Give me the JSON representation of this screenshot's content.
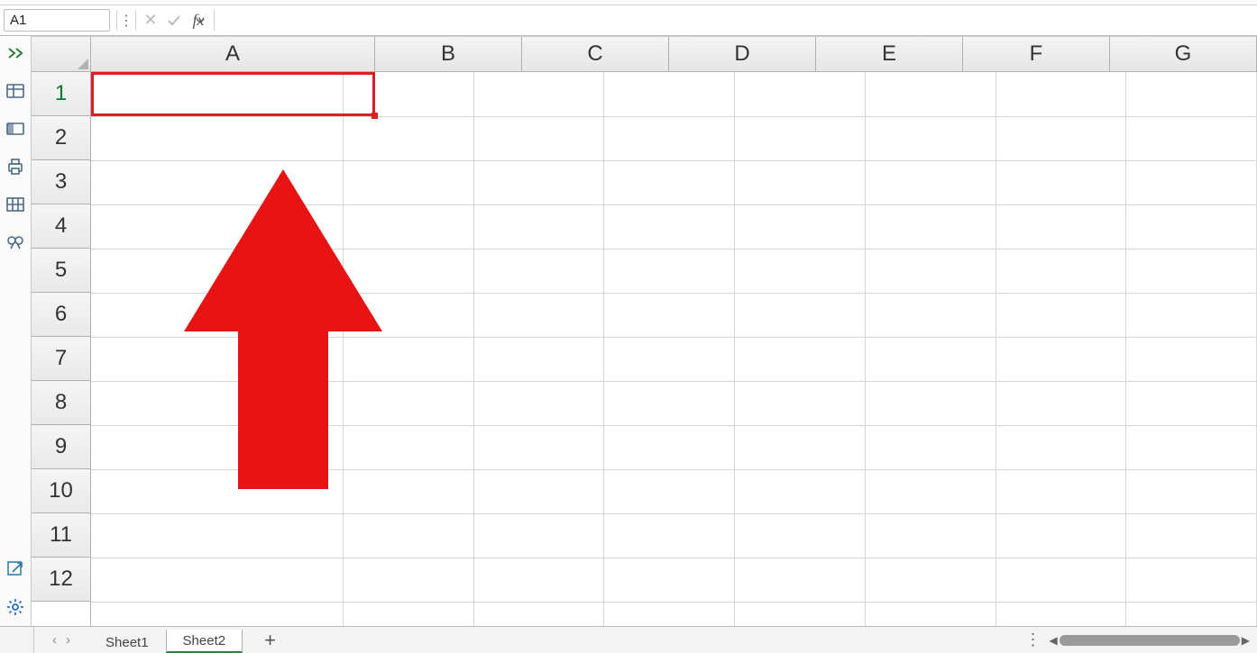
{
  "formula_bar": {
    "cell_ref": "A1",
    "fx_label": "fx",
    "formula_value": ""
  },
  "columns": [
    "A",
    "B",
    "C",
    "D",
    "E",
    "F",
    "G"
  ],
  "rows": [
    "1",
    "2",
    "3",
    "4",
    "5",
    "6",
    "7",
    "8",
    "9",
    "10",
    "11",
    "12"
  ],
  "selected_cell": "A1",
  "sheets": {
    "items": [
      "Sheet1",
      "Sheet2"
    ],
    "active_index": 1,
    "add_label": "+"
  },
  "sidebar_icons": [
    "expand",
    "styles",
    "gallery",
    "print",
    "grid",
    "find"
  ],
  "sidebar_bottom_icons": [
    "link",
    "settings"
  ],
  "annotation": {
    "arrow_color": "#e81313"
  }
}
